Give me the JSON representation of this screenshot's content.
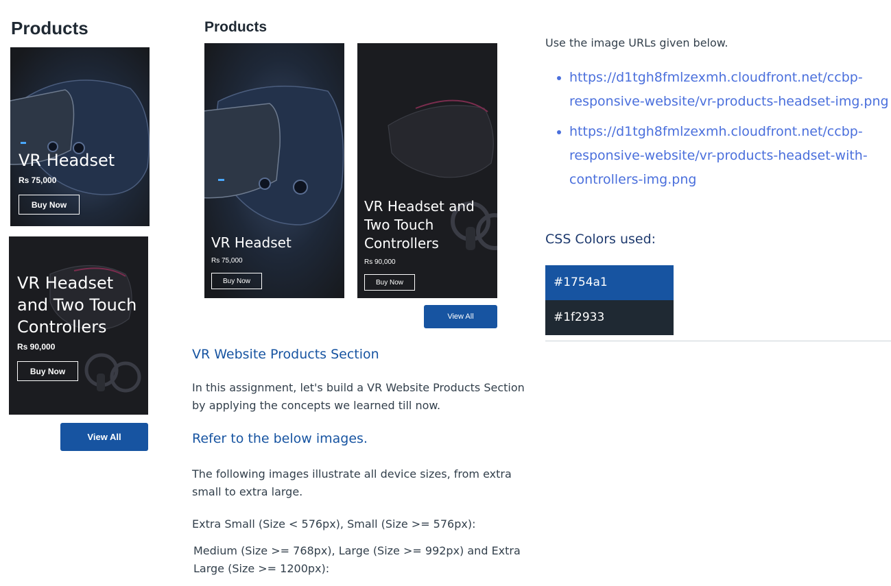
{
  "left_preview": {
    "heading": "Products",
    "cards": [
      {
        "name": "VR Headset",
        "price": "Rs 75,000",
        "button": "Buy Now"
      },
      {
        "name": "VR Headset and Two Touch Controllers",
        "price": "Rs 90,000",
        "button": "Buy Now"
      }
    ],
    "view_all": "View All"
  },
  "middle_preview": {
    "heading": "Products",
    "cards": [
      {
        "name": "VR Headset",
        "price": "Rs 75,000",
        "button": "Buy Now"
      },
      {
        "name": "VR Headset and Two Touch Controllers",
        "price": "Rs 90,000",
        "button": "Buy Now"
      }
    ],
    "view_all": "View All"
  },
  "description": {
    "title": "VR Website Products Section",
    "intro": "In this assignment, let's build a VR Website Products Section by applying the concepts we learned till now.",
    "refer_title": "Refer to the below images.",
    "illustrate": "The following images illustrate all device sizes, from extra small to extra large.",
    "sizes_small": "Extra Small (Size < 576px), Small (Size >= 576px):",
    "sizes_large": "Medium (Size >= 768px), Large (Size >= 992px) and Extra Large (Size >= 1200px):"
  },
  "resources": {
    "image_urls_label": "Use the image URLs given below.",
    "urls": [
      "https://d1tgh8fmlzexmh.cloudfront.net/ccbp-responsive-website/vr-products-headset-img.png",
      "https://d1tgh8fmlzexmh.cloudfront.net/ccbp-responsive-website/vr-products-headset-with-controllers-img.png"
    ],
    "colors_label": "CSS Colors used:",
    "colors": [
      {
        "label": "#1754a1",
        "hex": "#1754a1"
      },
      {
        "label": "#1f2933",
        "hex": "#1f2933"
      }
    ]
  }
}
